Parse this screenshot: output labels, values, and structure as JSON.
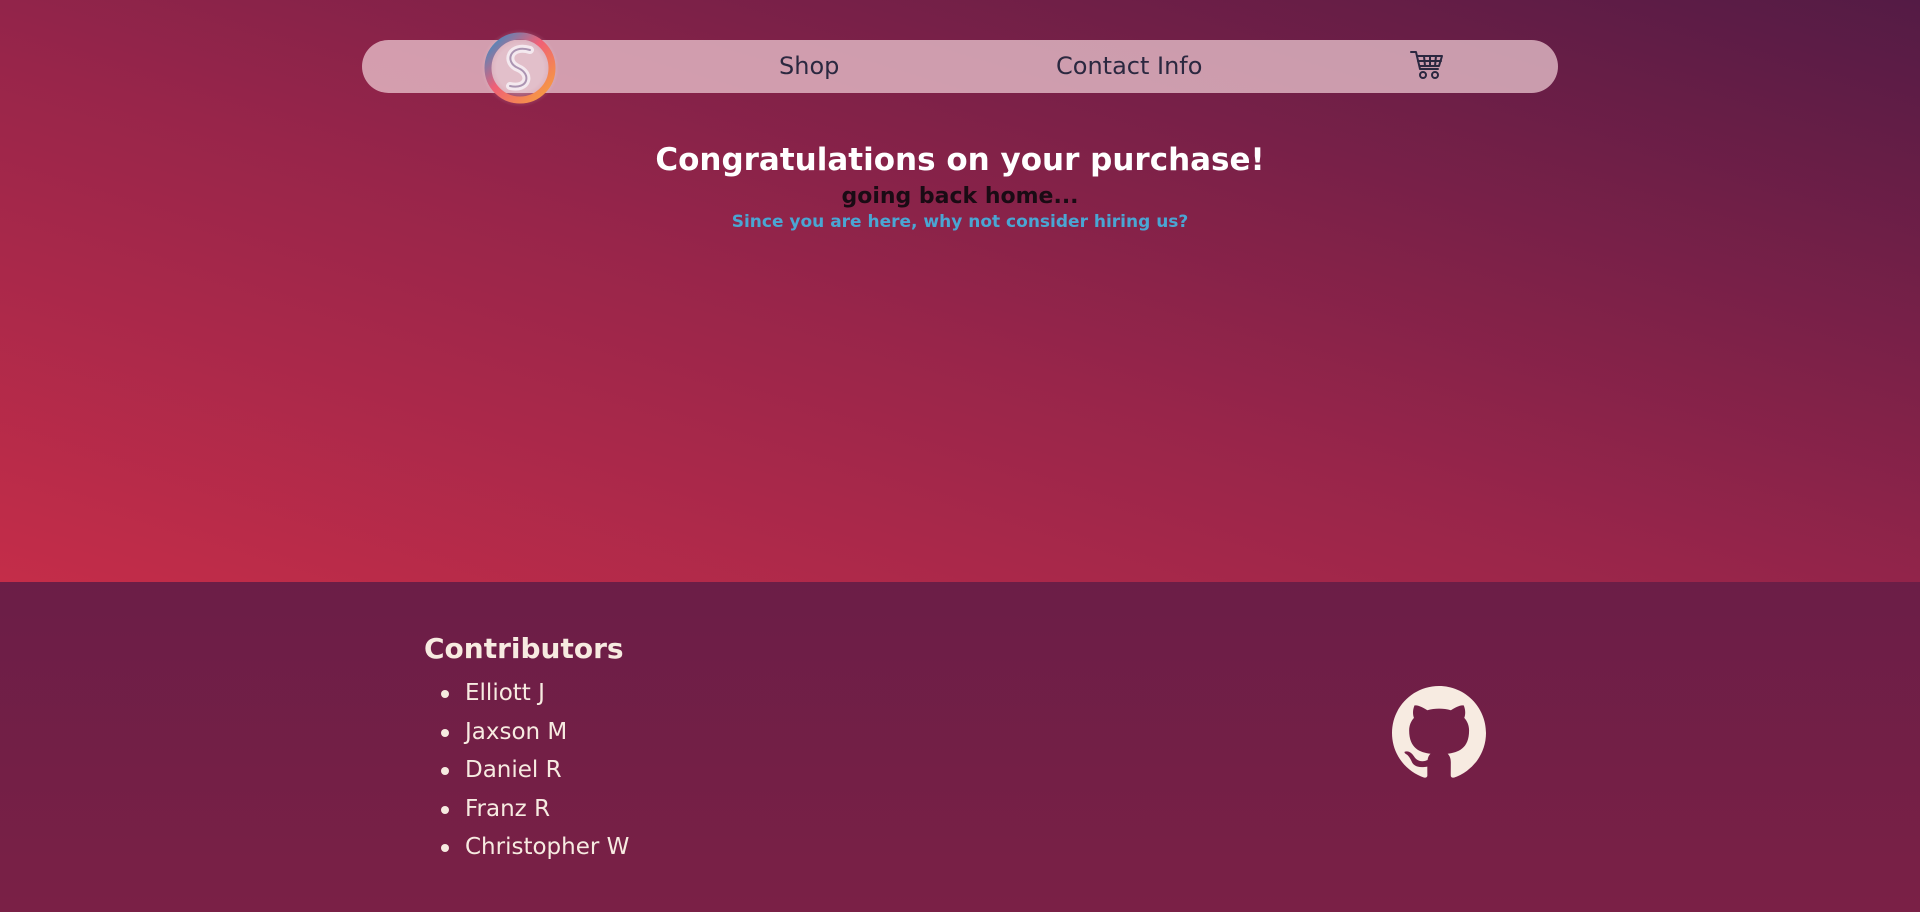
{
  "colors": {
    "hero_gradient_start": "#c42d49",
    "hero_gradient_end": "#541b45",
    "footer_background": "#6f1f46",
    "navbar_background": "#f0cdd6",
    "link_accent": "#4aa6d3",
    "footer_text": "#f7ebe1"
  },
  "nav": {
    "logo_icon": "swirl-s-logo",
    "links": [
      {
        "label": "Shop"
      },
      {
        "label": "Contact Info"
      }
    ],
    "cart_icon": "shopping-cart-icon"
  },
  "main": {
    "title": "Congratulations on your purchase!",
    "subtitle": "going back home...",
    "hire_link": "Since you are here, why not consider hiring us?"
  },
  "footer": {
    "contributors_title": "Contributors",
    "contributors": [
      "Elliott J",
      "Jaxson M",
      "Daniel R",
      "Franz R",
      "Christopher W"
    ],
    "github_icon": "github-icon"
  }
}
